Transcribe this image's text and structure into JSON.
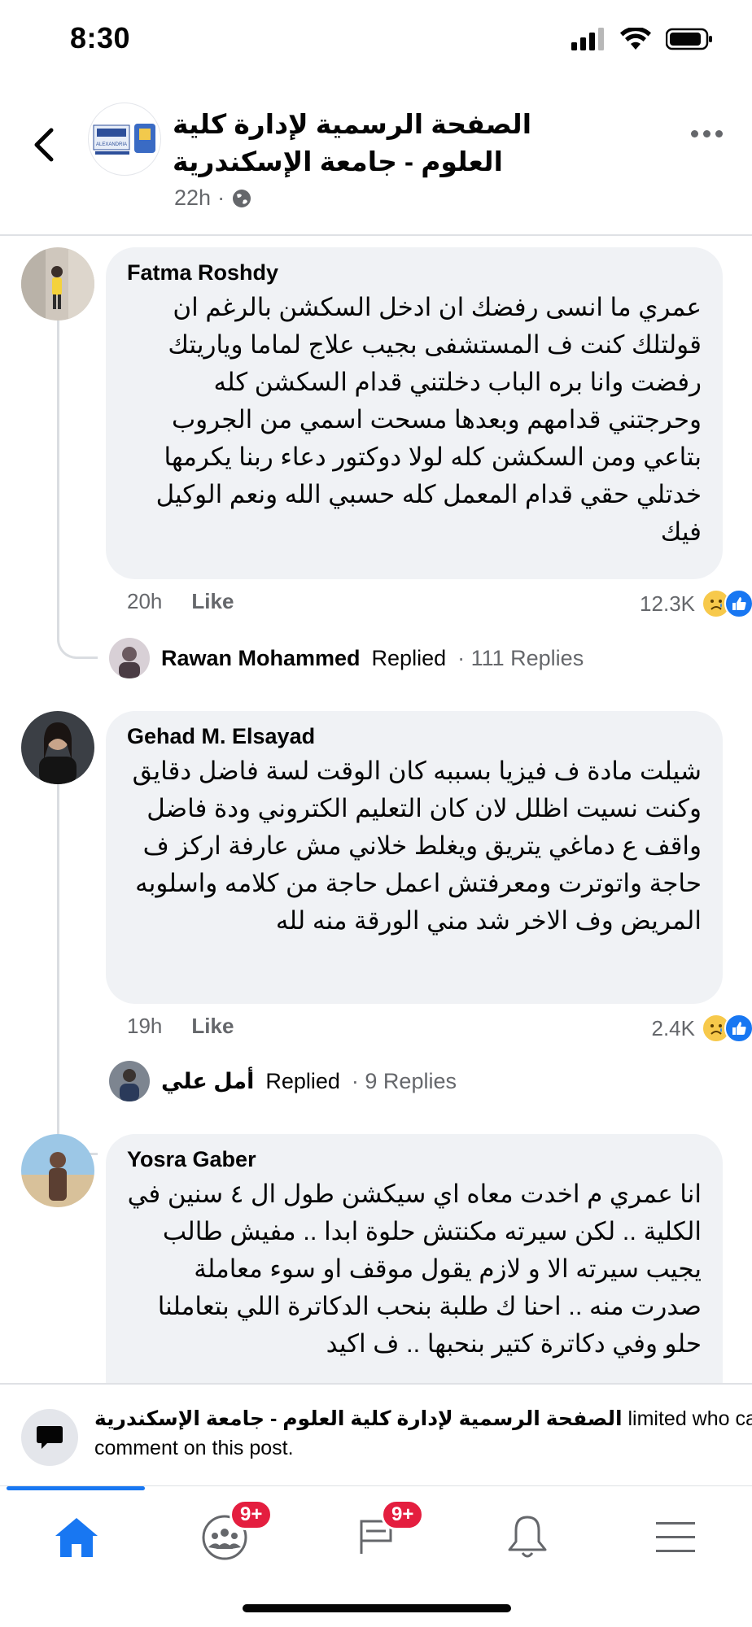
{
  "status": {
    "time": "8:30"
  },
  "header": {
    "title": "الصفحة الرسمية لإدارة كلية العلوم - جامعة الإسكندرية",
    "time": "22h",
    "separator": "·",
    "avatar_text": "ALEXANDRIA"
  },
  "comments": [
    {
      "author": "Fatma Roshdy",
      "text": "عمري ما انسى رفضك ان ادخل السكشن بالرغم ان قولتلك كنت ف المستشفى بجيب علاج لماما وياريتك رفضت وانا بره الباب دخلتني قدام السكشن كله وحرجتني قدامهم وبعدها مسحت اسمي من الجروب بتاعي ومن السكشن كله لولا دوكتور دعاء ربنا يكرمها خدتلي حقي قدام المعمل كله حسبي الله ونعم الوكيل فيك",
      "time": "20h",
      "like_label": "Like",
      "reaction_count": "12.3K",
      "reply": {
        "name": "Rawan Mohammed",
        "replied": "Replied",
        "count": "· 111 Replies"
      }
    },
    {
      "author": "Gehad M. Elsayad",
      "text": "شيلت مادة ف فيزيا بسببه كان الوقت لسة فاضل دقايق وكنت نسيت اظلل لان كان التعليم الكتروني ودة فاضل واقف ع دماغي يتريق ويغلط خلاني مش عارفة اركز ف حاجة واتوترت ومعرفتش اعمل حاجة من كلامه واسلوبه المريض وف الاخر شد مني الورقة منه لله",
      "time": "19h",
      "like_label": "Like",
      "reaction_count": "2.4K",
      "reply": {
        "name": "أمل علي",
        "replied": "Replied",
        "count": "· 9 Replies"
      }
    },
    {
      "author": "Yosra Gaber",
      "text": "انا عمري م اخدت معاه اي سيكشن طول ال ٤ سنين في الكلية .. لكن سيرته مكنتش حلوة ابدا .. مفيش طالب يجيب سيرته الا و لازم يقول موقف او سوء معاملة صدرت منه .. احنا ك طلبة بنحب الدكاترة اللي بتعاملنا حلو وفي دكاترة كتير بنحبها .. ف اكيد"
    }
  ],
  "restriction": {
    "page_name": "الصفحة الرسمية لإدارة كلية العلوم - جامعة الإسكندرية",
    "line1_suffix": "limited who can",
    "line2": "comment on this post."
  },
  "tabs": {
    "groups_badge": "9+",
    "feeds_badge": "9+"
  },
  "colors": {
    "accent": "#1877f2",
    "badge": "#e41e3f",
    "bubble": "#f0f2f5",
    "secondary_text": "#65676b"
  }
}
